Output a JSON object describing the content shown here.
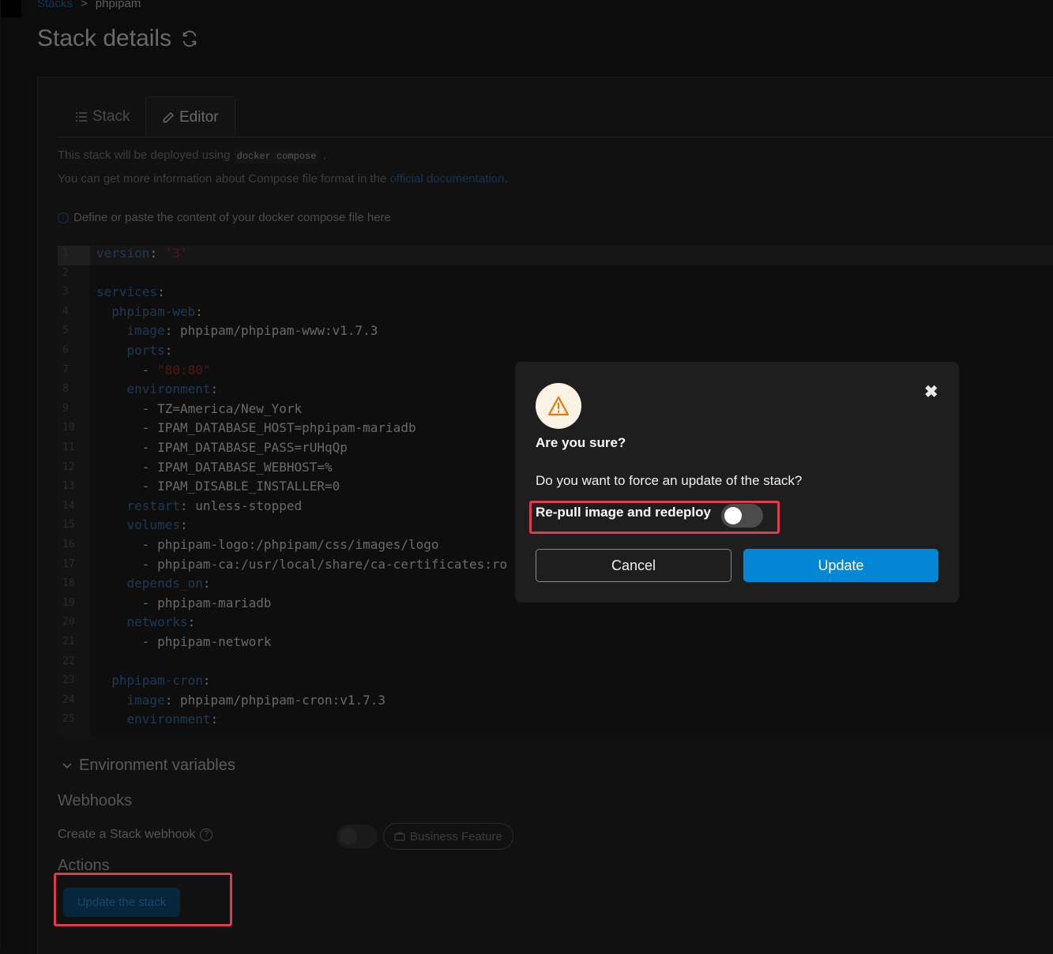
{
  "breadcrumb": {
    "parent": "Stacks",
    "separator": ">",
    "current": "phpipam"
  },
  "page_title": "Stack details",
  "tabs": [
    {
      "label": "Stack",
      "icon": "list-icon"
    },
    {
      "label": "Editor",
      "icon": "pencil-icon"
    }
  ],
  "editor_tab": {
    "deploy_prefix": "This stack will be deployed using",
    "deploy_code": "docker compose",
    "deploy_suffix": ".",
    "docs_prefix": "You can get more information about Compose file format in the",
    "docs_link": "official documentation",
    "docs_suffix": ".",
    "define_hint": "Define or paste the content of your docker compose file here"
  },
  "code_lines": [
    "version: '3'",
    "",
    "services:",
    "  phpipam-web:",
    "    image: phpipam/phpipam-www:v1.7.3",
    "    ports:",
    "      - \"80:80\"",
    "    environment:",
    "      - TZ=America/New_York",
    "      - IPAM_DATABASE_HOST=phpipam-mariadb",
    "      - IPAM_DATABASE_PASS=rUHqQp",
    "      - IPAM_DATABASE_WEBHOST=%",
    "      - IPAM_DISABLE_INSTALLER=0",
    "    restart: unless-stopped",
    "    volumes:",
    "      - phpipam-logo:/phpipam/css/images/logo",
    "      - phpipam-ca:/usr/local/share/ca-certificates:ro",
    "    depends_on:",
    "      - phpipam-mariadb",
    "    networks:",
    "      - phpipam-network",
    "",
    "  phpipam-cron:",
    "    image: phpipam/phpipam-cron:v1.7.3",
    "    environment:"
  ],
  "env_vars_label": "Environment variables",
  "webhooks": {
    "heading": "Webhooks",
    "create_label": "Create a Stack webhook",
    "badge": "Business Feature"
  },
  "actions": {
    "heading": "Actions",
    "update_stack_label": "Update the stack"
  },
  "modal": {
    "title": "Are you sure?",
    "question": "Do you want to force an update of the stack?",
    "repull_label": "Re-pull image and redeploy",
    "repull_enabled": false,
    "cancel_label": "Cancel",
    "update_label": "Update"
  },
  "colors": {
    "accent": "#0387d4",
    "highlight": "#e03a4e",
    "warning": "#e8780c"
  }
}
